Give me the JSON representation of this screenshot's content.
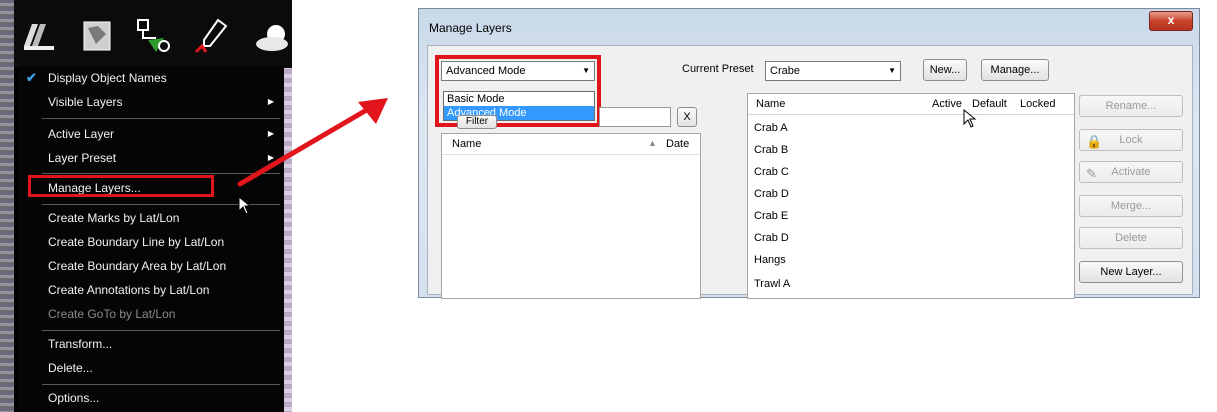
{
  "menu": {
    "items": [
      {
        "label": "Display Object Names",
        "checked": true,
        "submenu": false,
        "disabled": false
      },
      {
        "label": "Visible Layers",
        "checked": false,
        "submenu": true,
        "disabled": false
      },
      {
        "label": "Active Layer",
        "checked": false,
        "submenu": true,
        "disabled": false
      },
      {
        "label": "Layer Preset",
        "checked": false,
        "submenu": true,
        "disabled": false
      },
      {
        "label": "Manage Layers...",
        "checked": false,
        "submenu": false,
        "disabled": false
      },
      {
        "label": "Create Marks by Lat/Lon",
        "checked": false,
        "submenu": false,
        "disabled": false
      },
      {
        "label": "Create Boundary Line by Lat/Lon",
        "checked": false,
        "submenu": false,
        "disabled": false
      },
      {
        "label": "Create Boundary Area by Lat/Lon",
        "checked": false,
        "submenu": false,
        "disabled": false
      },
      {
        "label": "Create Annotations by Lat/Lon",
        "checked": false,
        "submenu": false,
        "disabled": false
      },
      {
        "label": "Create GoTo by Lat/Lon",
        "checked": false,
        "submenu": false,
        "disabled": true
      },
      {
        "label": "Transform...",
        "checked": false,
        "submenu": false,
        "disabled": false
      },
      {
        "label": "Delete...",
        "checked": false,
        "submenu": false,
        "disabled": false
      },
      {
        "label": "Options...",
        "checked": false,
        "submenu": false,
        "disabled": false
      }
    ],
    "toolbar_icons": [
      "layers-icon",
      "chart-icon",
      "route-icon",
      "pen-icon",
      "weather-icon"
    ]
  },
  "dialog": {
    "title": "Manage Layers",
    "close_label": "x",
    "mode_select": {
      "value": "Advanced Mode",
      "options": [
        "Basic Mode",
        "Advanced Mode"
      ],
      "selected_index": 1
    },
    "preset_label": "Current Preset",
    "preset_value": "Crabe",
    "new_label": "New...",
    "manage_label": "Manage...",
    "filter_label": "Filter",
    "clear_label": "X",
    "left_list": {
      "col_name": "Name",
      "col_date": "Date"
    },
    "layers_list": {
      "columns": [
        "Name",
        "Active",
        "Default",
        "Locked"
      ],
      "rows": [
        "Crab A",
        "Crab B",
        "Crab C",
        "Crab D",
        "Crab E",
        "Crab D",
        "Hangs",
        "Trawl A"
      ]
    },
    "side_buttons": [
      {
        "label": "Rename...",
        "disabled": true,
        "icon": ""
      },
      {
        "label": "Lock",
        "disabled": true,
        "icon": "lock-icon"
      },
      {
        "label": "Activate",
        "disabled": true,
        "icon": "pencil-icon"
      },
      {
        "label": "Merge...",
        "disabled": true,
        "icon": ""
      },
      {
        "label": "Delete",
        "disabled": true,
        "icon": ""
      },
      {
        "label": "New Layer...",
        "disabled": false,
        "icon": ""
      }
    ]
  },
  "colors": {
    "highlight": "#e3151c",
    "selection": "#3399ff",
    "check": "#3fa0e8"
  }
}
